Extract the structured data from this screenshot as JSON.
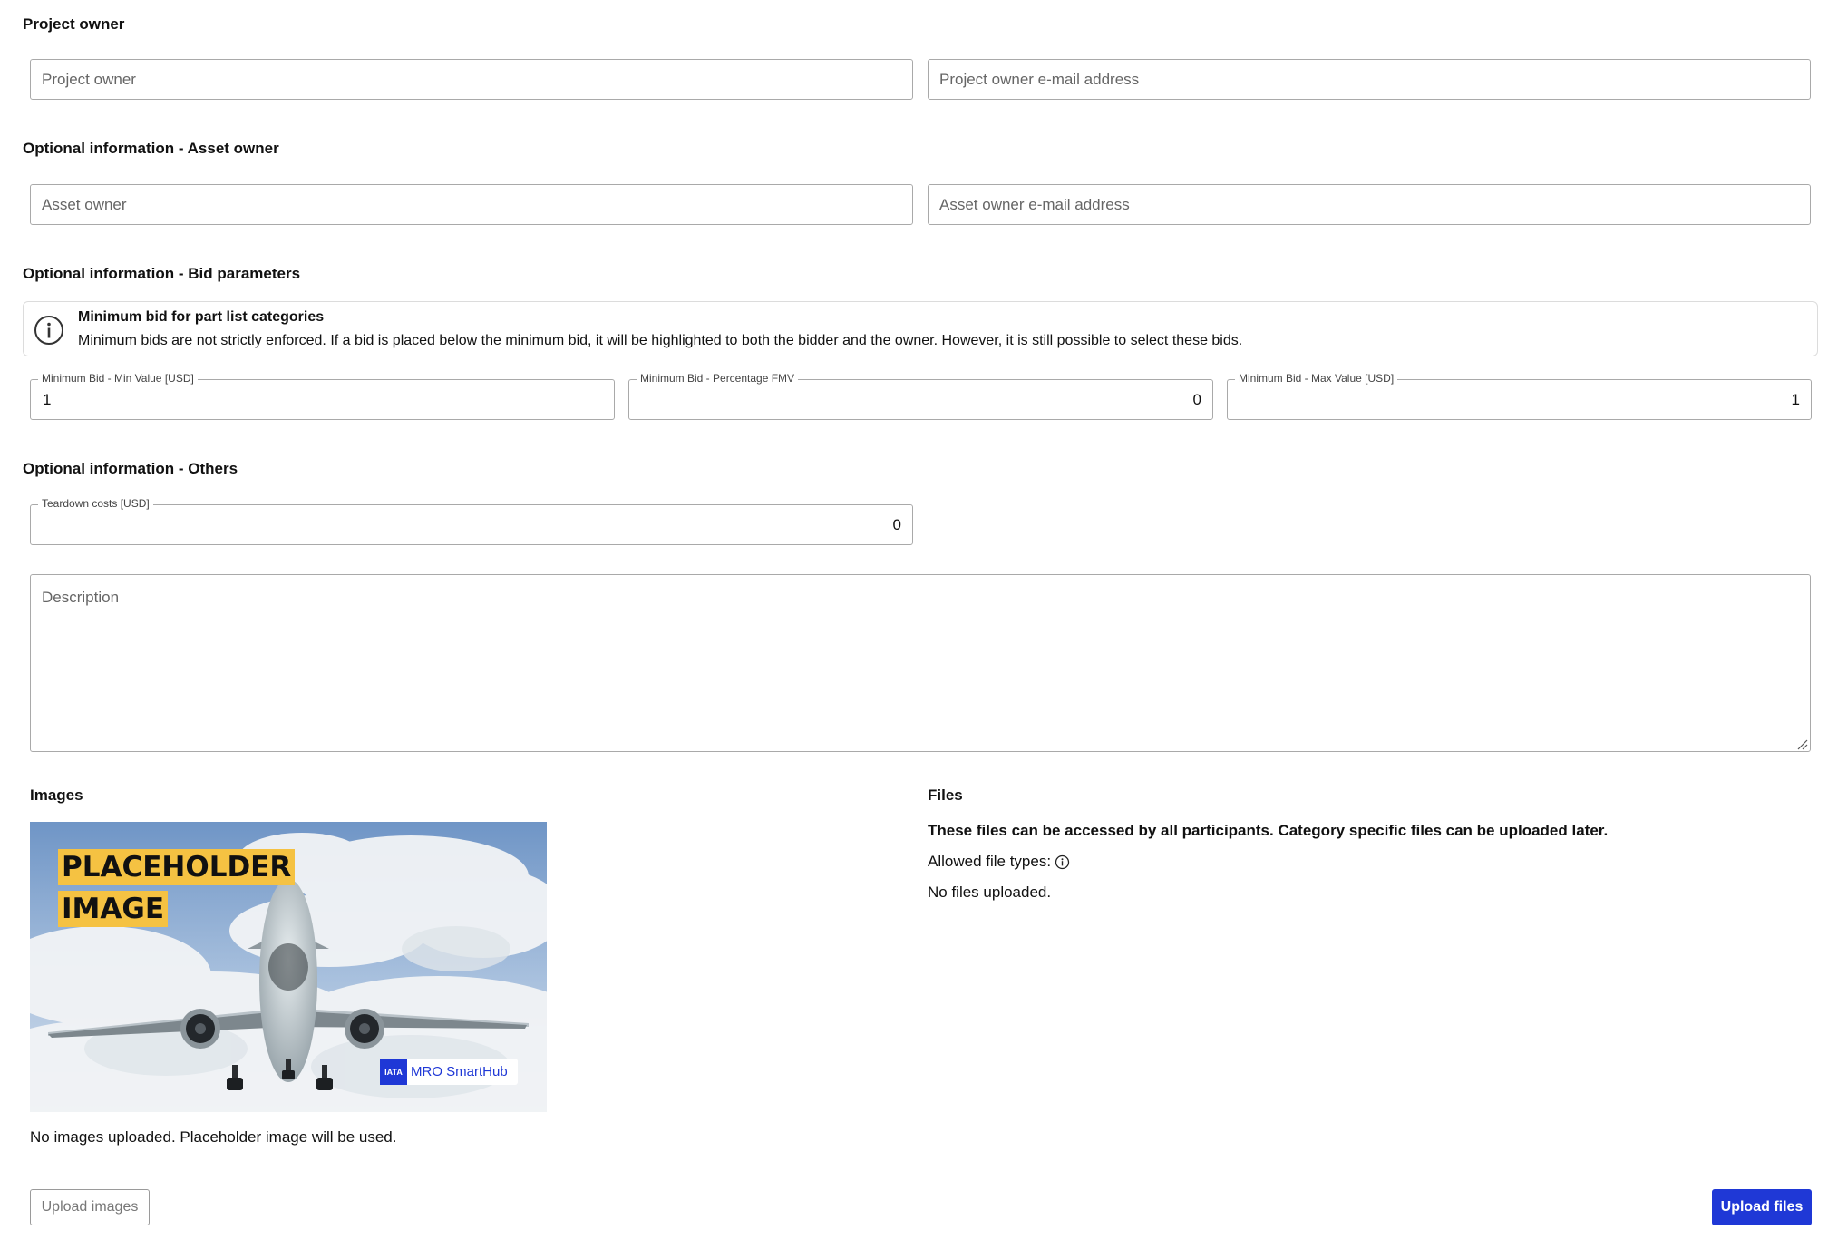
{
  "sections": {
    "project_owner": "Project owner",
    "asset_owner": "Optional information - Asset owner",
    "bid_parameters": "Optional information - Bid parameters",
    "others": "Optional information - Others"
  },
  "project_owner": {
    "name_placeholder": "Project owner",
    "email_placeholder": "Project owner e-mail address"
  },
  "asset_owner": {
    "name_placeholder": "Asset owner",
    "email_placeholder": "Asset owner e-mail address"
  },
  "bid_info": {
    "icon": "info-icon",
    "title": "Minimum bid for part list categories",
    "text": "Minimum bids are not strictly enforced. If a bid is placed below the minimum bid, it will be highlighted to both the bidder and the owner. However, it is still possible to select these bids."
  },
  "bid_fields": {
    "min_value_label": "Minimum Bid - Min Value [USD]",
    "min_value": "1",
    "percentage_label": "Minimum Bid - Percentage FMV",
    "percentage": "0",
    "max_value_label": "Minimum Bid - Max Value [USD]",
    "max_value": "1"
  },
  "others": {
    "teardown_label": "Teardown costs [USD]",
    "teardown_value": "0",
    "description_placeholder": "Description"
  },
  "images": {
    "title": "Images",
    "placeholder_line1": "PLACEHOLDER",
    "placeholder_line2": "IMAGE",
    "brand_badge": "IATA",
    "brand_text": "MRO SmartHub",
    "status": "No images uploaded. Placeholder image will be used.",
    "upload_label": "Upload images"
  },
  "files": {
    "title": "Files",
    "note": "These files can be accessed by all participants. Category specific files can be uploaded later.",
    "allowed_label": "Allowed file types:",
    "status": "No files uploaded.",
    "upload_label": "Upload files"
  },
  "colors": {
    "primary": "#1f38d6",
    "placeholder_yellow": "#f5c242"
  }
}
